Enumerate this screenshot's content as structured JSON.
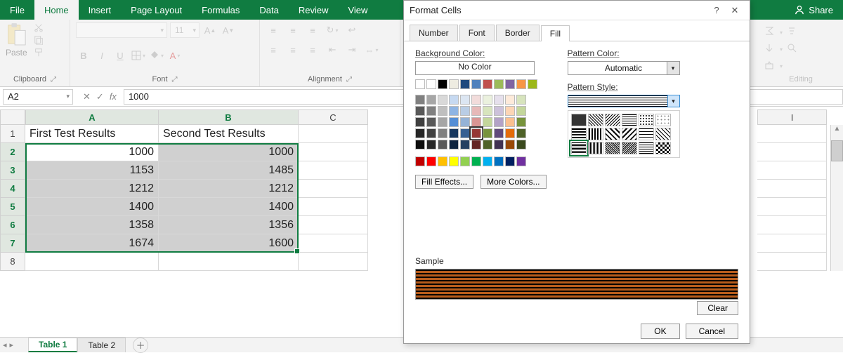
{
  "ribbon": {
    "tabs": [
      "File",
      "Home",
      "Insert",
      "Page Layout",
      "Formulas",
      "Data",
      "Review",
      "View"
    ],
    "active_tab": "Home",
    "share": "Share"
  },
  "clipboard": {
    "paste": "Paste",
    "group_label": "Clipboard"
  },
  "font": {
    "font_name": "",
    "font_size": "11",
    "bold": "B",
    "italic": "I",
    "underline": "U",
    "group_label": "Font"
  },
  "alignment": {
    "group_label": "Alignment"
  },
  "editing": {
    "group_label": "Editing"
  },
  "name_box": "A2",
  "formula_value": "1000",
  "columns": {
    "A": "A",
    "B": "B",
    "C": "C",
    "I": "I"
  },
  "row_numbers": [
    "1",
    "2",
    "3",
    "4",
    "5",
    "6",
    "7",
    "8"
  ],
  "headers": {
    "A": "First Test Results",
    "B": "Second Test Results"
  },
  "data": {
    "A": [
      "1000",
      "1153",
      "1212",
      "1400",
      "1358",
      "1674"
    ],
    "B": [
      "1000",
      "1485",
      "1212",
      "1400",
      "1356",
      "1600"
    ]
  },
  "sheet_tabs": [
    "Table 1",
    "Table 2"
  ],
  "active_sheet": "Table 1",
  "dialog": {
    "title": "Format Cells",
    "tabs": [
      "Number",
      "Font",
      "Border",
      "Fill"
    ],
    "active_tab": "Fill",
    "bg_label": "Background Color:",
    "no_color": "No Color",
    "fill_effects": "Fill Effects...",
    "more_colors": "More Colors...",
    "pattern_color_label": "Pattern Color:",
    "pattern_color_value": "Automatic",
    "pattern_style_label": "Pattern Style:",
    "sample_label": "Sample",
    "clear": "Clear",
    "ok": "OK",
    "cancel": "Cancel"
  },
  "swatches": {
    "top": [
      "#ffffff",
      "#000000",
      "#eeece1",
      "#1f497d",
      "#4f81bd",
      "#c0504d",
      "#9bbb59",
      "#8064a2",
      "#f79646",
      "#9cb819"
    ],
    "grid": [
      [
        "#808080",
        "#a6a6a6",
        "#d9d9d9",
        "#c6d9f1",
        "#dce6f2",
        "#f2dcdb",
        "#ebf1de",
        "#e6e0ec",
        "#fdeada",
        "#d7e4bd"
      ],
      [
        "#595959",
        "#808080",
        "#bfbfbf",
        "#8eb4e3",
        "#b9cde5",
        "#e6b9b8",
        "#d7e4bd",
        "#ccc1da",
        "#fcd5b5",
        "#c3d69b"
      ],
      [
        "#404040",
        "#595959",
        "#a6a6a6",
        "#558ed5",
        "#95b3d7",
        "#d99694",
        "#c3d69b",
        "#b3a2c7",
        "#fac090",
        "#77933c"
      ],
      [
        "#262626",
        "#404040",
        "#808080",
        "#17375e",
        "#376092",
        "#953735",
        "#77933c",
        "#604a7b",
        "#e46c0a",
        "#4f6228"
      ],
      [
        "#0d0d0d",
        "#262626",
        "#595959",
        "#0f243f",
        "#254061",
        "#632523",
        "#4f6228",
        "#403152",
        "#984807",
        "#3b4a1e"
      ]
    ],
    "std": [
      "#c00000",
      "#ff0000",
      "#ffc000",
      "#ffff00",
      "#92d050",
      "#00b050",
      "#00b0f0",
      "#0070c0",
      "#002060",
      "#7030a0"
    ]
  },
  "pattern_colors": [
    "#ffffff",
    "#f2dcdb",
    "#e46c0a",
    "#953735",
    "#632523",
    "#000000"
  ],
  "selected_bg_index": "grid.3.5"
}
